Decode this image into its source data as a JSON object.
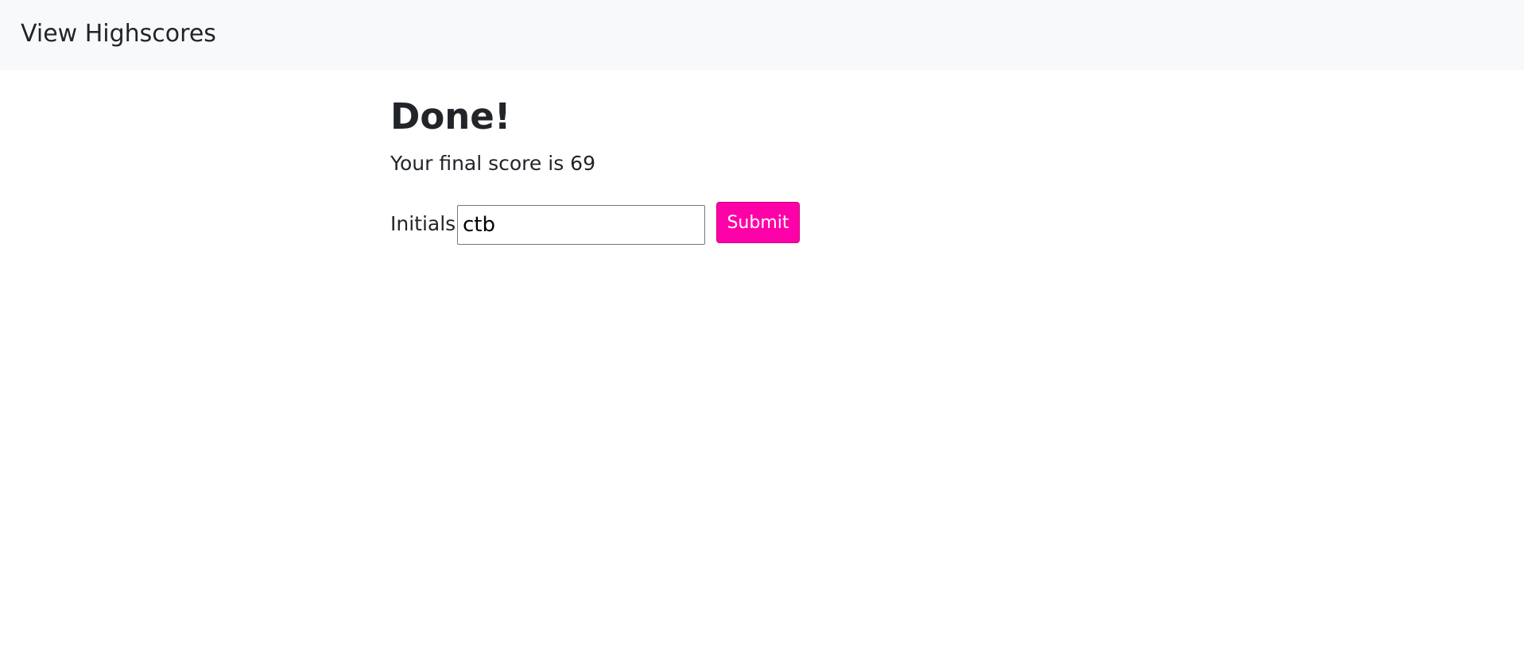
{
  "navbar": {
    "link_label": "View Highscores"
  },
  "main": {
    "title": "Done!",
    "score_text": "Your final score is 69",
    "form": {
      "label": "Initials",
      "input_value": "ctb",
      "submit_label": "Submit"
    }
  },
  "colors": {
    "accent": "#ff00a8",
    "navbar_bg": "#f8f9fa",
    "text": "#212529"
  }
}
